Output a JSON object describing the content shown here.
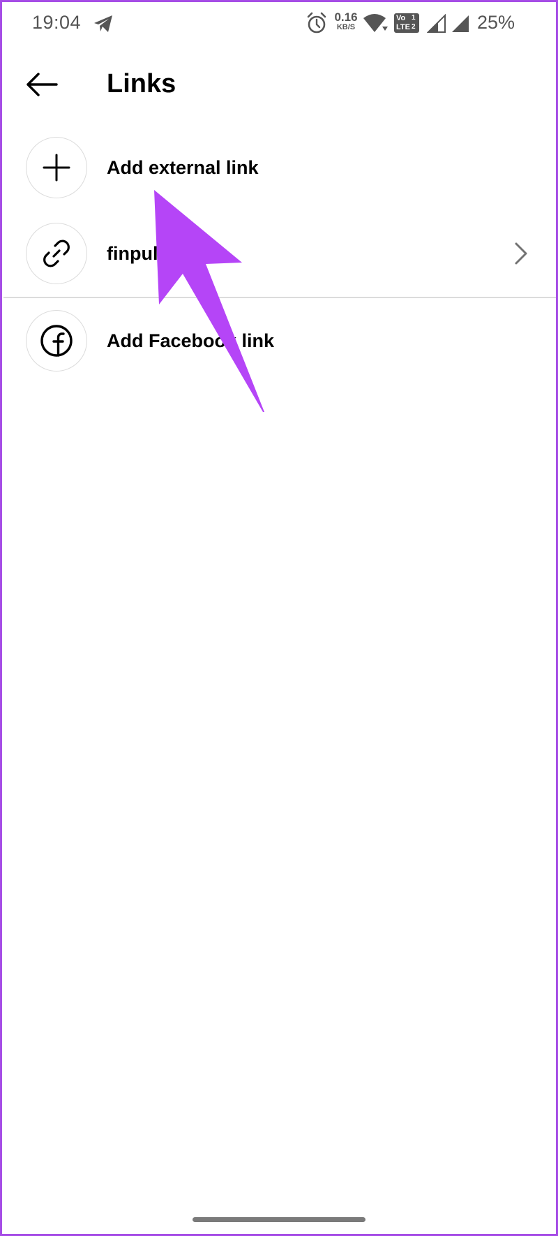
{
  "status_bar": {
    "time": "19:04",
    "net_speed_value": "0.16",
    "net_speed_unit": "KB/S",
    "volte_top": "Vo",
    "volte_sim": "1",
    "volte_network": "LTE",
    "volte_sim2": "2",
    "battery": "25%"
  },
  "header": {
    "title": "Links",
    "back_icon": "arrow-left-icon"
  },
  "links": [
    {
      "icon": "plus-icon",
      "label": "Add external link",
      "has_chevron": false
    },
    {
      "icon": "chain-link-icon",
      "label": "finpul",
      "has_chevron": true
    },
    {
      "icon": "facebook-icon",
      "label": "Add Facebook link",
      "has_chevron": false
    }
  ],
  "colors": {
    "annotation_arrow": "#b545f7",
    "frame_border": "#a64de6",
    "divider": "#dbdbdb",
    "icon_circle_border": "#dbdbdb",
    "status_text": "#555555"
  }
}
